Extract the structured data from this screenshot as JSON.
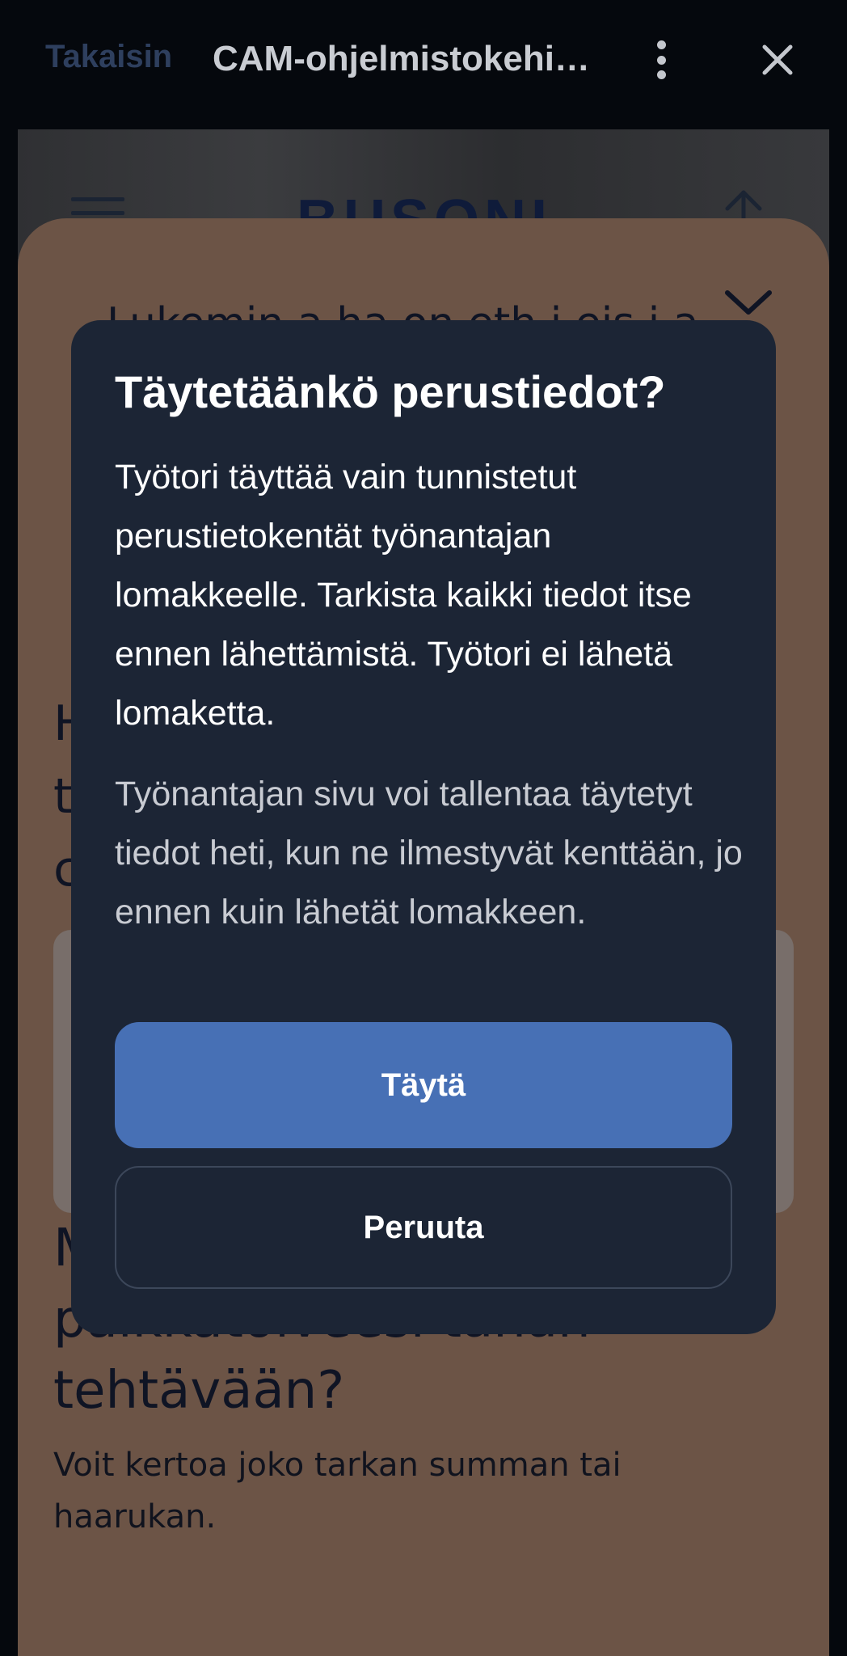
{
  "topbar": {
    "back_label": "Takaisin",
    "page_title": "CAM-ohjelmistokehit…"
  },
  "web": {
    "logo": "BUSONI",
    "sheet_question": "Lukemin a ha on eth i eis i a 2",
    "ghost_h": "H",
    "ghost_t": "t",
    "ghost_c": "c",
    "salary_heading": "Mikä on alustava palkkatoiveesi tähän tehtävään?",
    "salary_desc": "Voit kertoa joko tarkan summan tai haarukan."
  },
  "dialog": {
    "title": "Täytetäänkö perustiedot?",
    "body": "Työtori täyttää vain tunnistetut perustietokentät työnantajan lomakkeelle. Tarkista kaikki tiedot itse ennen lähettämistä. Työtori ei lähetä lomaketta.",
    "note": "Työnantajan sivu voi tallentaa täytetyt tiedot heti, kun ne ilmestyvät kenttään, jo ennen kuin lähetät lomakkeen.",
    "fill_label": "Täytä",
    "cancel_label": "Peruuta"
  },
  "colors": {
    "dialog_bg": "#1c2535",
    "primary_button": "#4770b5",
    "sheet_bg": "#6c5446"
  },
  "icons": {
    "more": "more-vertical-icon",
    "close": "close-icon",
    "menu": "hamburger-icon",
    "up": "arrow-up-icon",
    "collapse": "chevron-down-icon"
  }
}
